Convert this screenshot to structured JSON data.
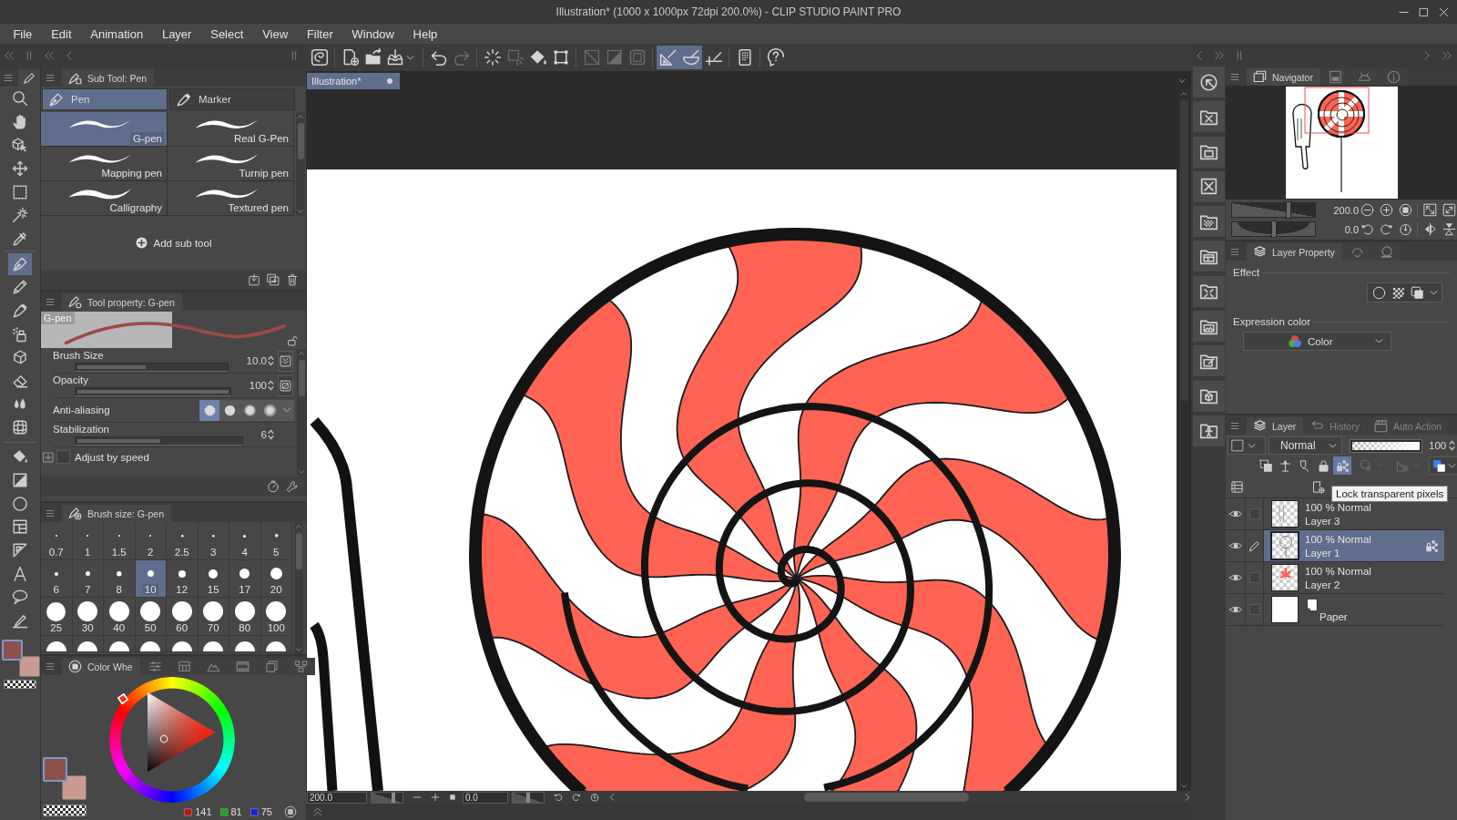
{
  "window": {
    "title": "Illustration* (1000 x 1000px 72dpi 200.0%) - CLIP STUDIO PAINT PRO"
  },
  "menu": [
    "File",
    "Edit",
    "Animation",
    "Layer",
    "Select",
    "View",
    "Filter",
    "Window",
    "Help"
  ],
  "command_bar": {
    "buttons": [
      {
        "on": false,
        "disabled": false
      },
      {
        "on": false,
        "disabled": false
      },
      {
        "on": false,
        "disabled": false
      },
      {
        "on": false,
        "disabled": false
      },
      {
        "on": false,
        "disabled": false
      },
      {
        "on": false,
        "disabled": true
      },
      {
        "on": false,
        "disabled": false
      },
      {
        "on": false,
        "disabled": true
      },
      {
        "on": false,
        "disabled": false
      },
      {
        "on": false,
        "disabled": false
      },
      {
        "on": false,
        "disabled": true
      },
      {
        "on": false,
        "disabled": true
      },
      {
        "on": false,
        "disabled": true
      },
      {
        "on": true,
        "disabled": false
      },
      {
        "on": true,
        "disabled": false
      },
      {
        "on": false,
        "disabled": false
      },
      {
        "on": false,
        "disabled": false
      },
      {
        "on": false,
        "disabled": false
      }
    ]
  },
  "tools": {
    "items": [
      {
        "selected": false
      },
      {
        "selected": false
      },
      {
        "selected": false
      },
      {
        "selected": false
      },
      {
        "selected": false
      },
      {
        "selected": false
      },
      {
        "selected": false
      },
      {
        "selected": true
      },
      {
        "selected": false
      },
      {
        "selected": false
      },
      {
        "selected": false
      },
      {
        "selected": false
      },
      {
        "selected": false
      },
      {
        "selected": false
      },
      {
        "selected": false
      },
      {
        "selected": false
      },
      {
        "selected": false
      },
      {
        "selected": false
      },
      {
        "selected": false
      },
      {
        "selected": false
      },
      {
        "selected": false
      },
      {
        "selected": false
      },
      {
        "selected": false
      }
    ],
    "swatches": [
      {
        "color": "#8d514b"
      },
      {
        "color": "#c99b8e"
      }
    ]
  },
  "sub_tool": {
    "title": "Sub Tool: Pen",
    "groups": [
      {
        "label": "Pen",
        "selected": true
      },
      {
        "label": "Marker",
        "selected": false
      }
    ],
    "brushes": [
      {
        "label": "G-pen",
        "selected": true
      },
      {
        "label": "Real G-Pen",
        "selected": false
      },
      {
        "label": "Mapping pen",
        "selected": false
      },
      {
        "label": "Turnip pen",
        "selected": false
      },
      {
        "label": "Calligraphy",
        "selected": false
      },
      {
        "label": "Textured pen",
        "selected": false
      }
    ],
    "add_label": "Add sub tool"
  },
  "tool_property": {
    "title": "Tool property: G-pen",
    "preview_label": "G-pen",
    "settings": [
      {
        "kind": "slider",
        "label": "Brush Size",
        "value": "10.0",
        "level": 0.46,
        "pressure_button": true,
        "pressure": true
      },
      {
        "kind": "slider",
        "label": "Opacity",
        "value": "100",
        "level": 1,
        "pressure_button": true,
        "pressure": false
      },
      {
        "kind": "options",
        "label": "Anti-aliasing",
        "options": [
          {
            "selected": true
          },
          {
            "selected": false
          },
          {
            "selected": false
          },
          {
            "selected": false
          }
        ]
      },
      {
        "kind": "slider",
        "label": "Stabilization",
        "value": "6",
        "level": 0.51
      },
      {
        "kind": "checkbox",
        "label": "Adjust by speed",
        "checked": false
      }
    ]
  },
  "brush_size": {
    "title": "Brush size: G-pen",
    "sizes": [
      {
        "label": "0.7",
        "selected": false
      },
      {
        "label": "1",
        "selected": false
      },
      {
        "label": "1.5",
        "selected": false
      },
      {
        "label": "2",
        "selected": false
      },
      {
        "label": "2.5",
        "selected": false
      },
      {
        "label": "3",
        "selected": false
      },
      {
        "label": "4",
        "selected": false
      },
      {
        "label": "5",
        "selected": false
      },
      {
        "label": "6",
        "selected": false
      },
      {
        "label": "7",
        "selected": false
      },
      {
        "label": "8",
        "selected": false
      },
      {
        "label": "10",
        "selected": true
      },
      {
        "label": "12",
        "selected": false
      },
      {
        "label": "15",
        "selected": false
      },
      {
        "label": "17",
        "selected": false
      },
      {
        "label": "20",
        "selected": false
      },
      {
        "label": "25",
        "selected": false
      },
      {
        "label": "30",
        "selected": false
      },
      {
        "label": "40",
        "selected": false
      },
      {
        "label": "50",
        "selected": false
      },
      {
        "label": "60",
        "selected": false
      },
      {
        "label": "70",
        "selected": false
      },
      {
        "label": "80",
        "selected": false
      },
      {
        "label": "100",
        "selected": false
      }
    ]
  },
  "color_wheel": {
    "tabs": [
      {
        "label": "Color Whe",
        "selected": true
      },
      {
        "selected": false
      },
      {
        "selected": false
      },
      {
        "selected": false
      },
      {
        "selected": false
      },
      {
        "selected": false
      },
      {
        "selected": false
      }
    ],
    "swatches": [
      {
        "color": "#8d514b"
      },
      {
        "color": "#c99b8e"
      }
    ],
    "rgb": [
      "141",
      "81",
      "75"
    ]
  },
  "canvas": {
    "tabs": [
      {
        "label": "Illustration*",
        "selected": true
      }
    ],
    "zoom": {
      "value": "200.0",
      "level": 0.7
    },
    "angle": {
      "value": "0.0",
      "level": 0.5
    }
  },
  "navigator": {
    "tabs": [
      {
        "label": "Navigator",
        "selected": true
      },
      {
        "selected": false
      },
      {
        "selected": false
      },
      {
        "selected": false
      }
    ],
    "zoom": {
      "value": "200.0",
      "level": 0.68
    },
    "rotation": {
      "value": "0.0",
      "level": 0.51
    }
  },
  "layer_property": {
    "tabs": [
      {
        "label": "Layer Property",
        "selected": true
      },
      {
        "selected": false
      },
      {
        "selected": false
      }
    ],
    "effect_label": "Effect",
    "expression_label": "Expression color",
    "expression_value": "Color"
  },
  "layer_panel": {
    "tabs": [
      {
        "label": "Layer",
        "selected": true
      },
      {
        "label": "History",
        "selected": false
      },
      {
        "label": "Auto Action",
        "selected": false
      }
    ],
    "blend_mode": "Normal",
    "opacity": {
      "value": "100",
      "level": 1
    },
    "lock_buttons": [
      {
        "on": false
      },
      {
        "on": false
      },
      {
        "on": false
      },
      {
        "on": false
      },
      {
        "on": true
      }
    ],
    "tooltip": "Lock transparent pixels",
    "layers": [
      {
        "kind": "raster",
        "info": "100 % Normal",
        "name": "Layer 3",
        "visible": true,
        "selected": false,
        "lock_transparent": false
      },
      {
        "kind": "raster",
        "info": "100 % Normal",
        "name": "Layer 1",
        "visible": true,
        "selected": true,
        "lock_transparent": true
      },
      {
        "kind": "raster",
        "info": "100 % Normal",
        "name": "Layer 2",
        "visible": true,
        "selected": false,
        "lock_transparent": false
      },
      {
        "kind": "paper",
        "name": "Paper",
        "visible": true,
        "selected": false
      }
    ]
  }
}
